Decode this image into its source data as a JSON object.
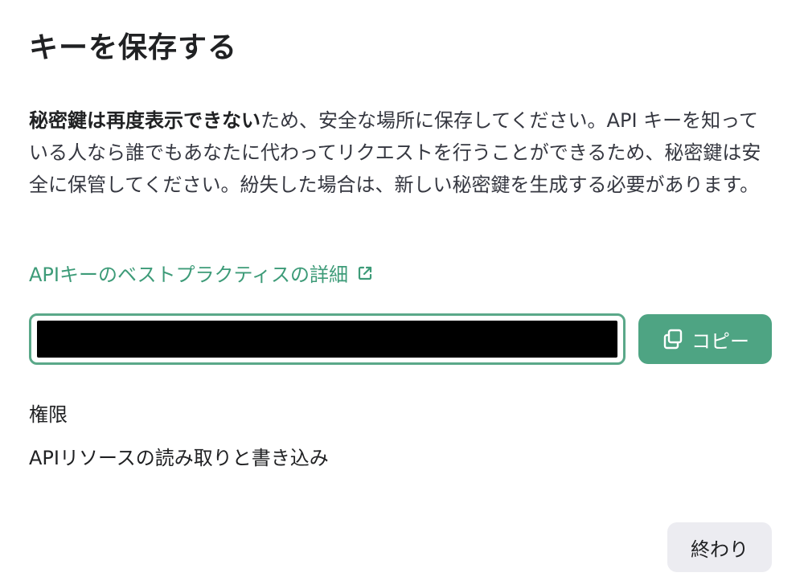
{
  "dialog": {
    "title": "キーを保存する",
    "description_bold": "秘密鍵は再度表示できない",
    "description_rest": "ため、安全な場所に保存してください。API キーを知っている人なら誰でもあなたに代わってリクエストを行うことができるため、秘密鍵は安全に保管してください。紛失した場合は、新しい秘密鍵を生成する必要があります。",
    "learn_more_link": "APIキーのベストプラクティスの詳細",
    "learn_more_icon": "external-link-icon",
    "key_field": {
      "value": "",
      "masked": true
    },
    "copy_button": {
      "label": "コピー",
      "icon": "copy-icon"
    },
    "permissions": {
      "label": "権限",
      "value": "APIリソースの読み取りと書き込み"
    },
    "done_button": {
      "label": "終わり"
    }
  },
  "colors": {
    "accent": "#4ea483",
    "link": "#3d9b78",
    "field_border": "#5aa889",
    "secondary_button": "#ececf1",
    "text": "#202123"
  }
}
